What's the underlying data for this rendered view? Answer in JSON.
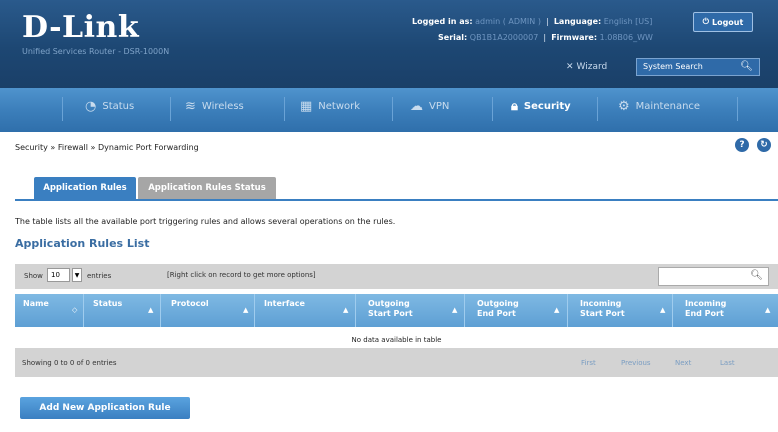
{
  "header": {
    "brand": "D-Link",
    "subtitle": "Unified Services Router - DSR-1000N",
    "logged_in_label": "Logged in as:",
    "logged_in_value": "admin ( ADMIN )",
    "language_label": "Language:",
    "language_value": "English [US]",
    "logout_label": "Logout",
    "serial_label": "Serial:",
    "serial_value": "QB1B1A2000007",
    "firmware_label": "Firmware:",
    "firmware_value": "1.08B06_WW",
    "wizard_label": "Wizard",
    "system_search_placeholder": "System Search"
  },
  "nav": [
    {
      "label": "Status",
      "icon": "gauge-icon"
    },
    {
      "label": "Wireless",
      "icon": "wifi-icon"
    },
    {
      "label": "Network",
      "icon": "network-icon"
    },
    {
      "label": "VPN",
      "icon": "cloud-icon"
    },
    {
      "label": "Security",
      "icon": "lock-icon",
      "active": true
    },
    {
      "label": "Maintenance",
      "icon": "gear-icon"
    }
  ],
  "breadcrumb": "Security  »  Firewall  »  Dynamic Port Forwarding",
  "tabs": [
    {
      "label": "Application Rules",
      "active": true
    },
    {
      "label": "Application Rules Status",
      "active": false
    }
  ],
  "description": "The table lists all the available port triggering rules and allows several operations on the rules.",
  "list_title": "Application Rules List",
  "table": {
    "show_label": "Show",
    "show_value": "10",
    "entries_label": "entries",
    "hint": "[Right click on record to get more options]",
    "columns": [
      {
        "label": "Name",
        "label2": ""
      },
      {
        "label": "Status",
        "label2": ""
      },
      {
        "label": "Protocol",
        "label2": ""
      },
      {
        "label": "Interface",
        "label2": ""
      },
      {
        "label": "Outgoing",
        "label2": "Start Port"
      },
      {
        "label": "Outgoing",
        "label2": "End Port"
      },
      {
        "label": "Incoming",
        "label2": "Start Port"
      },
      {
        "label": "Incoming",
        "label2": "End Port"
      }
    ],
    "no_data": "No data available in table",
    "showing": "Showing 0 to 0 of 0 entries",
    "pager": [
      "First",
      "Previous",
      "Next",
      "Last"
    ]
  },
  "add_button": "Add New Application Rule",
  "colors": {
    "header_bg": "#1d4773",
    "nav_bg": "#3c7fbb",
    "tab_active": "#3a7fc1",
    "tab_inactive": "#a6a6a6",
    "table_header": "#5e9fd4"
  }
}
